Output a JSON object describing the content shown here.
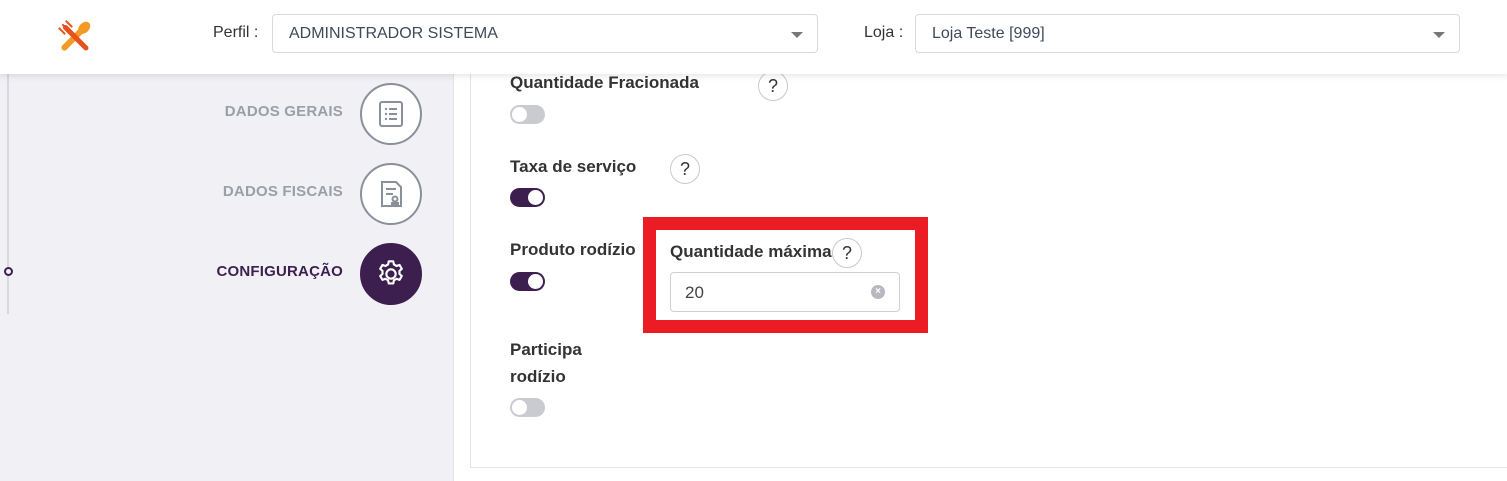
{
  "header": {
    "logo_icon": "fork-spoon-icon",
    "perfil_label": "Perfil :",
    "perfil_value": "ADMINISTRADOR SISTEMA",
    "loja_label": "Loja :",
    "loja_value": "Loja Teste [999]"
  },
  "steps": [
    {
      "label": "DADOS GERAIS",
      "icon": "list-document-icon",
      "active": false
    },
    {
      "label": "DADOS FISCAIS",
      "icon": "fiscal-document-icon",
      "active": false
    },
    {
      "label": "CONFIGURAÇÃO",
      "icon": "gear-icon",
      "active": true
    }
  ],
  "options": {
    "quantidade_fracionada": {
      "label": "Quantidade Fracionada",
      "enabled": false
    },
    "taxa_servico": {
      "label": "Taxa de serviço",
      "enabled": true
    },
    "produto_rodizio": {
      "label": "Produto rodízio",
      "enabled": true
    },
    "participa_rodizio": {
      "label_line1": "Participa",
      "label_line2": "rodízio",
      "enabled": false
    }
  },
  "quantidade_maxima": {
    "label": "Quantidade máxima",
    "value": "20"
  },
  "help_glyph": "?",
  "colors": {
    "accent": "#3d1f4f",
    "highlight": "#ec1c24",
    "toggle_off": "#c9cbd1",
    "inactive_step": "#9aa0a8"
  }
}
